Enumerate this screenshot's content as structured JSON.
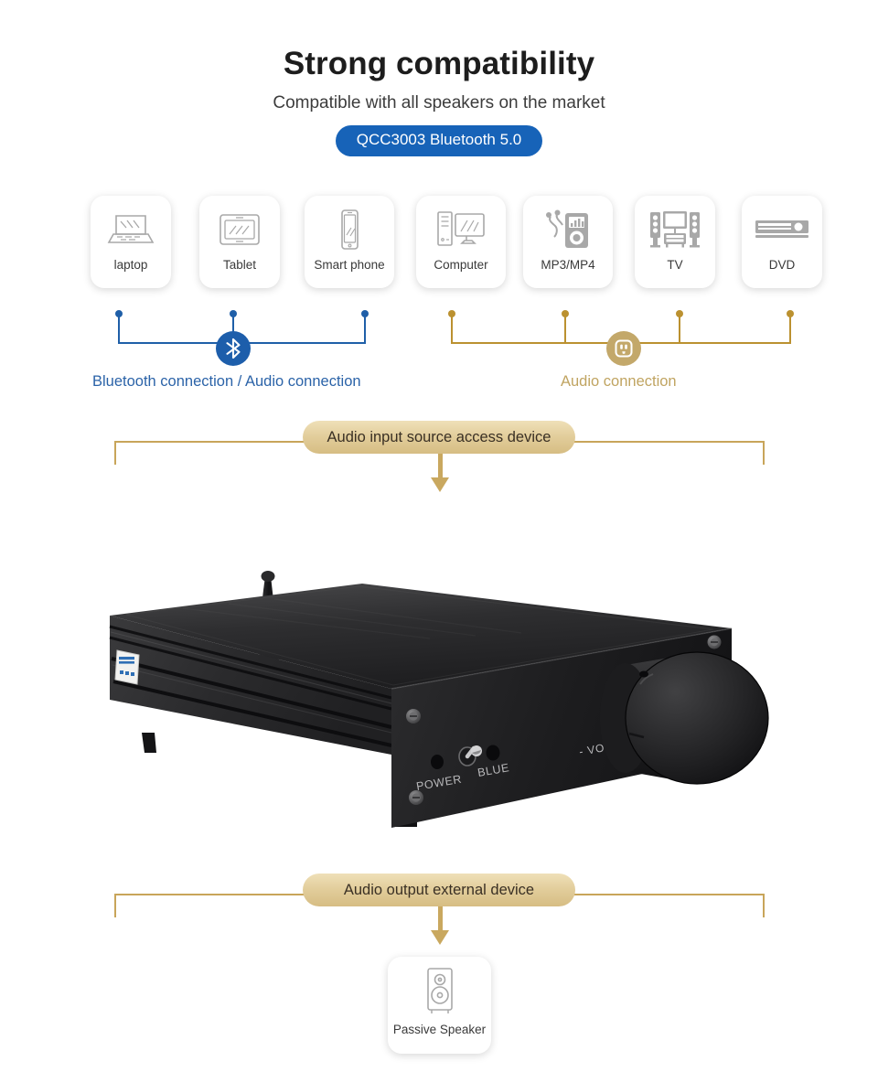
{
  "header": {
    "title": "Strong compatibility",
    "subtitle": "Compatible with all speakers on the market",
    "badge": "QCC3003 Bluetooth 5.0",
    "badge_color": "#1763b8"
  },
  "devices": [
    {
      "label": "laptop",
      "icon": "laptop-icon"
    },
    {
      "label": "Tablet",
      "icon": "tablet-icon"
    },
    {
      "label": "Smart phone",
      "icon": "smartphone-icon"
    },
    {
      "label": "Computer",
      "icon": "desktop-computer-icon"
    },
    {
      "label": "MP3/MP4",
      "icon": "mp3-player-icon"
    },
    {
      "label": "TV",
      "icon": "tv-system-icon"
    },
    {
      "label": "DVD",
      "icon": "dvd-player-icon"
    }
  ],
  "connections": {
    "bluetooth": {
      "label": "Bluetooth connection / Audio connection",
      "icon": "bluetooth-icon",
      "color": "#2b63a8",
      "line_color": "#1f5fa8"
    },
    "audio": {
      "label": "Audio connection",
      "icon": "power-outlet-icon",
      "color": "#c0a461",
      "line_color": "#bb9130"
    }
  },
  "flow": {
    "input_banner": "Audio input source access device",
    "output_banner": "Audio output external device",
    "banner_color": "#c8a55a"
  },
  "amplifier": {
    "power_label": "POWER",
    "blue_label": "BLUE",
    "volume_label": "- VOLUME +",
    "body_color": "#1a1a1a"
  },
  "output": {
    "speaker_label": "Passive Speaker",
    "speaker_icon": "passive-speaker-icon"
  }
}
